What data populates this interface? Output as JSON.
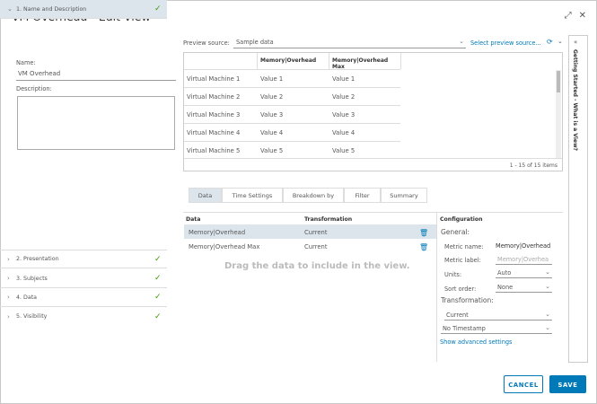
{
  "dialog": {
    "title": "VM Overhead - Edit View"
  },
  "steps": [
    {
      "label": "1. Name and Description"
    },
    {
      "label": "2. Presentation"
    },
    {
      "label": "3. Subjects"
    },
    {
      "label": "4. Data"
    },
    {
      "label": "5. Visibility"
    }
  ],
  "form": {
    "name_label": "Name:",
    "name_value": "VM Overhead",
    "description_label": "Description:"
  },
  "preview": {
    "source_label": "Preview source:",
    "source_value": "Sample data",
    "select_link": "Select preview source...",
    "columns": [
      "",
      "Memory|Overhead",
      "Memory|Overhead Max"
    ],
    "rows": [
      [
        "Virtual Machine 1",
        "Value 1",
        "Value 1"
      ],
      [
        "Virtual Machine 2",
        "Value 2",
        "Value 2"
      ],
      [
        "Virtual Machine 3",
        "Value 3",
        "Value 3"
      ],
      [
        "Virtual Machine 4",
        "Value 4",
        "Value 4"
      ],
      [
        "Virtual Machine 5",
        "Value 5",
        "Value 5"
      ]
    ],
    "footer": "1 - 15 of 15 items"
  },
  "tabs": [
    "Data",
    "Time Settings",
    "Breakdown by",
    "Filter",
    "Summary"
  ],
  "data_panel": {
    "col_data": "Data",
    "col_transformation": "Transformation",
    "rows": [
      {
        "data": "Memory|Overhead",
        "transformation": "Current"
      },
      {
        "data": "Memory|Overhead Max",
        "transformation": "Current"
      }
    ],
    "drag_hint": "Drag the data to include in the view."
  },
  "config": {
    "header": "Configuration",
    "general": "General:",
    "metric_name_label": "Metric name:",
    "metric_name_value": "Memory|Overhead",
    "metric_label_label": "Metric label:",
    "metric_label_placeholder": "Memory|Overhea",
    "units_label": "Units:",
    "units_value": "Auto",
    "sort_label": "Sort order:",
    "sort_value": "None",
    "transformation_label": "Transformation:",
    "transformation_value": "Current",
    "timestamp_value": "No Timestamp",
    "advanced_link": "Show advanced settings"
  },
  "side_tab": "Getting Started - What is a View?",
  "buttons": {
    "cancel": "CANCEL",
    "save": "SAVE"
  }
}
